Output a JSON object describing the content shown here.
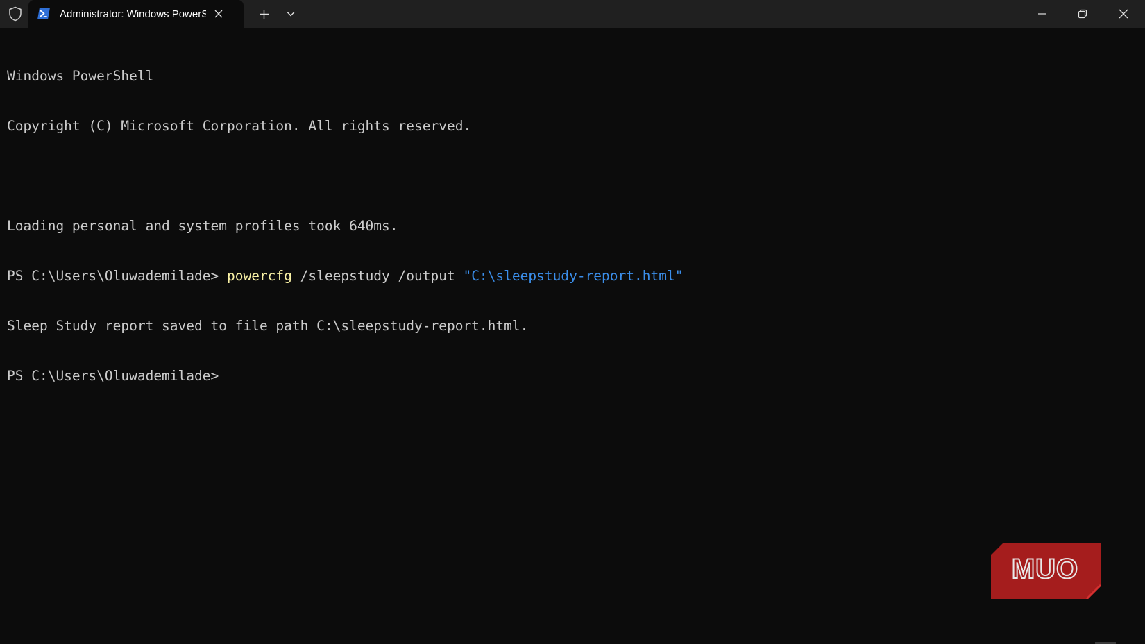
{
  "titlebar": {
    "shield_icon": "shield-icon",
    "tab": {
      "title": "Administrator: Windows PowerShell",
      "icon": "powershell-icon",
      "close_icon": "close-icon"
    },
    "new_tab_icon": "plus-icon",
    "dropdown_icon": "chevron-down-icon",
    "window_controls": [
      "minimize-icon",
      "restore-icon",
      "close-icon"
    ]
  },
  "terminal": {
    "lines": [
      "Windows PowerShell",
      "Copyright (C) Microsoft Corporation. All rights reserved.",
      "",
      "Loading personal and system profiles took 640ms."
    ],
    "prompt_1": "PS C:\\Users\\Oluwademilade> ",
    "command": "powercfg",
    "command_args": " /sleepstudy /output ",
    "command_string": "\"C:\\sleepstudy-report.html\"",
    "output": "Sleep Study report saved to file path C:\\sleepstudy-report.html.",
    "prompt_2": "PS C:\\Users\\Oluwademilade>"
  },
  "colors": {
    "background": "#0c0c0c",
    "titlebar": "#202020",
    "text": "#cccccc",
    "command": "#f9f1a5",
    "string": "#3b8eea",
    "logo": "#a51d1d"
  },
  "watermark": {
    "text": "MUO"
  }
}
